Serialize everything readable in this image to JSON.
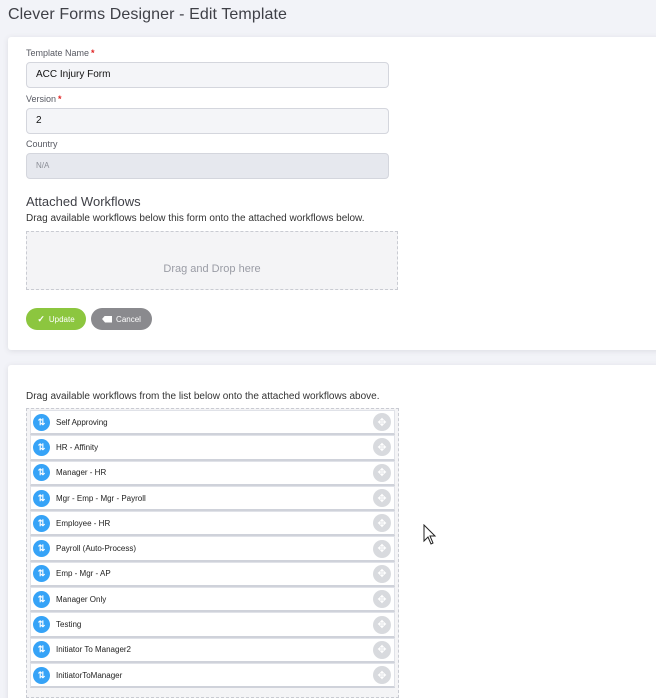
{
  "page": {
    "title": "Clever Forms Designer - Edit Template"
  },
  "form": {
    "template_name_label": "Template Name",
    "template_name_value": "ACC Injury Form",
    "version_label": "Version",
    "version_value": "2",
    "country_label": "Country",
    "country_value": "N/A",
    "required_marker": "*"
  },
  "attached": {
    "title": "Attached Workflows",
    "help": "Drag available workflows below this form onto the attached workflows below.",
    "dropzone_text": "Drag and Drop here"
  },
  "actions": {
    "update_label": "Update",
    "cancel_label": "Cancel"
  },
  "available": {
    "help": "Drag available workflows from the list below onto the attached workflows above.",
    "items": [
      {
        "label": "Self Approving"
      },
      {
        "label": "HR - Affinity"
      },
      {
        "label": "Manager - HR"
      },
      {
        "label": "Mgr - Emp - Mgr - Payroll"
      },
      {
        "label": "Employee - HR"
      },
      {
        "label": "Payroll (Auto-Process)"
      },
      {
        "label": "Emp - Mgr - AP"
      },
      {
        "label": "Manager Only"
      },
      {
        "label": "Testing"
      },
      {
        "label": "Initiator To Manager2"
      },
      {
        "label": "InitiatorToManager"
      }
    ]
  },
  "colors": {
    "accent_blue": "#36a3f7",
    "update_green": "#8cc63f",
    "cancel_gray": "#8a8a8e"
  },
  "icons": {
    "workflow": "workflow-icon",
    "move": "move-icon",
    "check": "check-icon",
    "backspace": "backspace-icon"
  }
}
